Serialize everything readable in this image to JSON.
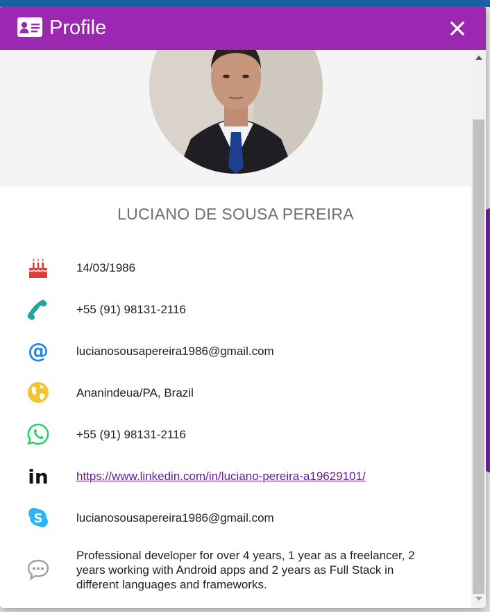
{
  "dialog": {
    "title": "Profile",
    "title_icon": "id-card-icon",
    "close_icon": "close-icon"
  },
  "profile": {
    "name": "LUCIANO DE SOUSA PEREIRA",
    "birthday": "14/03/1986",
    "phone": "+55 (91) 98131-2116",
    "email": "lucianosousapereira1986@gmail.com",
    "location": "Ananindeua/PA, Brazil",
    "whatsapp": "+55 (91) 98131-2116",
    "linkedin": "https://www.linkedin.com/in/luciano-pereira-a19629101/",
    "skype": "lucianosousapereira1986@gmail.com",
    "about": "Professional developer for over 4 years, 1 year as a freelancer, 2 years working with Android apps and 2 years as Full Stack in different languages and frameworks."
  },
  "icons": {
    "birthday": "birthday-cake-icon",
    "phone": "phone-icon",
    "email": "at-sign-icon",
    "location": "globe-icon",
    "whatsapp": "whatsapp-icon",
    "linkedin": "linkedin-icon",
    "skype": "skype-icon",
    "about": "speech-bubble-icon"
  },
  "colors": {
    "header": "#9c27b0",
    "cake": "#e53935",
    "phone": "#26a69a",
    "email": "#1e88e5",
    "globe": "#f4c430",
    "whatsapp": "#25d366",
    "linkedin": "#111111",
    "skype": "#29b6f6",
    "about": "#9e9e9e"
  }
}
